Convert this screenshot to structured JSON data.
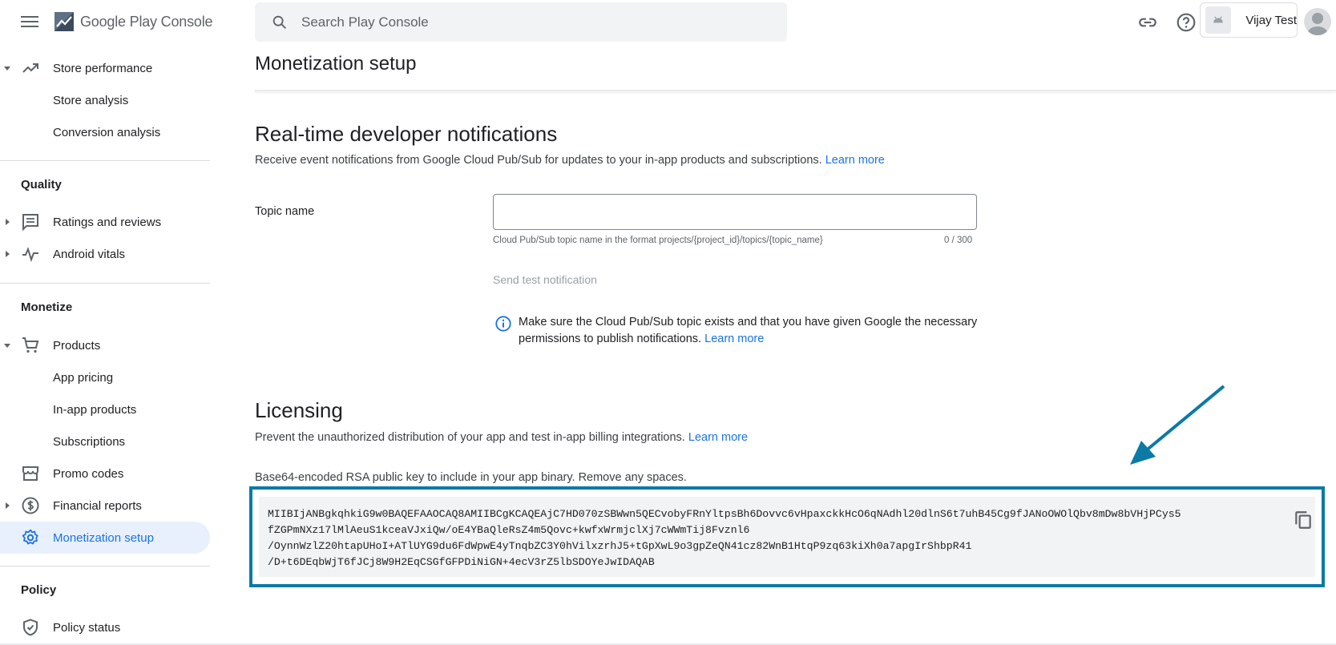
{
  "header": {
    "logo_text": "Google Play Console",
    "search_placeholder": "Search Play Console",
    "account_name": "Vijay Test"
  },
  "sidebar": {
    "items": [
      {
        "label": "Store performance",
        "icon": "trending-up-icon"
      },
      {
        "label": "Store analysis"
      },
      {
        "label": "Conversion analysis"
      },
      {
        "label": "Ratings and reviews",
        "icon": "reviews-icon"
      },
      {
        "label": "Android vitals",
        "icon": "vitals-icon"
      },
      {
        "label": "Products",
        "icon": "cart-icon"
      },
      {
        "label": "App pricing"
      },
      {
        "label": "In-app products"
      },
      {
        "label": "Subscriptions"
      },
      {
        "label": "Promo codes",
        "icon": "store-icon"
      },
      {
        "label": "Financial reports",
        "icon": "dollar-icon"
      },
      {
        "label": "Monetization setup",
        "icon": "gear-icon",
        "active": true
      },
      {
        "label": "Policy status",
        "icon": "shield-icon"
      }
    ],
    "sections": {
      "quality": "Quality",
      "monetize": "Monetize",
      "policy": "Policy"
    }
  },
  "main": {
    "page_title": "Monetization setup",
    "rtdn": {
      "title": "Real-time developer notifications",
      "description": "Receive event notifications from Google Cloud Pub/Sub for updates to your in-app products and subscriptions.",
      "learn_more": "Learn more",
      "topic_label": "Topic name",
      "topic_value": "",
      "helper": "Cloud Pub/Sub topic name in the format projects/{project_id}/topics/{topic_name}",
      "counter": "0 / 300",
      "send_button": "Send test notification",
      "info_text": "Make sure the Cloud Pub/Sub topic exists and that you have given Google the necessary permissions to publish notifications.",
      "info_link": "Learn more"
    },
    "licensing": {
      "title": "Licensing",
      "description": "Prevent the unauthorized distribution of your app and test in-app billing integrations.",
      "learn_more": "Learn more",
      "key_label": "Base64-encoded RSA public key to include in your app binary. Remove any spaces.",
      "key_lines": [
        "MIIBIjANBgkqhkiG9w0BAQEFAAOCAQ8AMIIBCgKCAQEAjC7HD070zSBWwn5QECvobyFRnYltpsBh6Dovvc6vHpaxckkHcO6qNAdhl20dlnS6t7uhB45Cg9fJANoOWOlQbv8mDw8bVHjPCys5",
        "fZGPmNXz17lMlAeuS1kceaVJxiQw/oE4YBaQleRsZ4m5Qovc+kwfxWrmjclXj7cWWmTij8Fvznl6",
        "/OynnWzlZ20htapUHoI+ATlUYG9du6FdWpwE4yTnqbZC3Y0hVilxzrhJ5+tGpXwL9o3gpZeQN41cz82WnB1HtqP9zq63kiXh0a7apgIrShbpR41",
        "/D+t6DEqbWjT6fJCj8W9H2EqCSGfGFPDiNiGN+4ecV3rZ5lbSDOYeJwIDAQAB"
      ]
    }
  },
  "colors": {
    "accent": "#1a73e8",
    "active_bg": "#e8f0fe",
    "annotation": "#0b7aa6"
  }
}
